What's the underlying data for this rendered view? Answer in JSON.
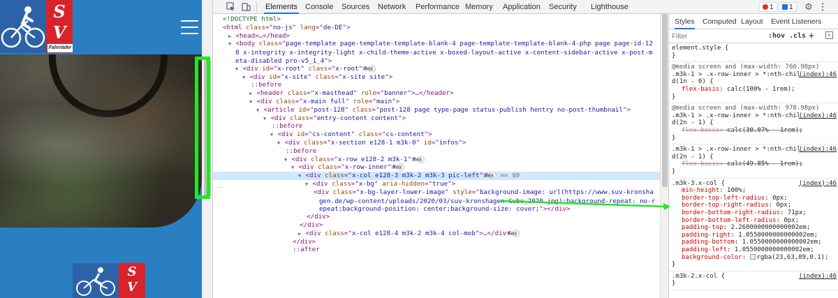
{
  "site": {
    "logo_letters": "S\nV",
    "logo_brand": "Fahrräder",
    "menu_icon": "hamburger-menu-icon"
  },
  "devtools": {
    "tabs": [
      "Elements",
      "Console",
      "Sources",
      "Network",
      "Performance",
      "Memory",
      "Application",
      "Security",
      "Lighthouse"
    ],
    "active_tab": "Elements",
    "error_count": "1",
    "message_count": "1",
    "colors": {
      "accent": "#1a73e8",
      "selected_row": "#cfe8fc",
      "highlight": "#22e822",
      "site_blue": "#2a7fc2",
      "logo_red": "#d8232a"
    }
  },
  "dom_lines": [
    {
      "indent": 0,
      "tri": "",
      "html": "<!DOCTYPE html>",
      "kind": "comment"
    },
    {
      "indent": 0,
      "tri": "",
      "tag": "html",
      "attrs": [
        [
          "class",
          "no-js"
        ],
        [
          "lang",
          "de-DE"
        ]
      ]
    },
    {
      "indent": 1,
      "tri": "▶",
      "raw": "<head>…</head>"
    },
    {
      "indent": 1,
      "tri": "▼",
      "tag": "body",
      "attrs": [
        [
          "class",
          "page-template page-template-template-blank-4 page-template-template-blank-4-php page page-id-128 x-integrity x-integrity-light x-child-theme-active x-boxed-layout-active x-content-sidebar-active x-post-meta-disabled pro-v5_1_4"
        ]
      ],
      "wrap": true
    },
    {
      "indent": 2,
      "tri": "▼",
      "tag": "div",
      "attrs": [
        [
          "id",
          "x-root"
        ],
        [
          "class",
          "x-root"
        ]
      ],
      "pill": "flex"
    },
    {
      "indent": 3,
      "tri": "▼",
      "tag": "div",
      "attrs": [
        [
          "id",
          "x-site"
        ],
        [
          "class",
          "x-site site"
        ]
      ]
    },
    {
      "indent": 4,
      "tri": "",
      "pseudo": "::before"
    },
    {
      "indent": 4,
      "tri": "▶",
      "tag": "header",
      "attrs": [
        [
          "class",
          "x-masthead"
        ],
        [
          "role",
          "banner"
        ]
      ],
      "collapsed": "header"
    },
    {
      "indent": 4,
      "tri": "▼",
      "tag": "div",
      "attrs": [
        [
          "class",
          "x-main full"
        ],
        [
          "role",
          "main"
        ]
      ]
    },
    {
      "indent": 5,
      "tri": "▼",
      "tag": "article",
      "attrs": [
        [
          "id",
          "post-128"
        ],
        [
          "class",
          "post-128 page type-page status-publish hentry no-post-thumbnail"
        ]
      ]
    },
    {
      "indent": 6,
      "tri": "▼",
      "tag": "div",
      "attrs": [
        [
          "class",
          "entry-content content"
        ]
      ]
    },
    {
      "indent": 7,
      "tri": "",
      "pseudo": "::before"
    },
    {
      "indent": 7,
      "tri": "▼",
      "tag": "div",
      "attrs": [
        [
          "id",
          "cs-content"
        ],
        [
          "class",
          "cs-content"
        ]
      ]
    },
    {
      "indent": 8,
      "tri": "▼",
      "tag": "div",
      "attrs": [
        [
          "class",
          "x-section e128-1 m3k-0"
        ],
        [
          "id",
          "infos"
        ]
      ]
    },
    {
      "indent": 9,
      "tri": "",
      "pseudo": "::before"
    },
    {
      "indent": 9,
      "tri": "▼",
      "tag": "div",
      "attrs": [
        [
          "class",
          "x-row e128-2 m3k-1"
        ]
      ],
      "pill": "flex"
    },
    {
      "indent": 10,
      "tri": "▼",
      "tag": "div",
      "attrs": [
        [
          "class",
          "x-row-inner"
        ]
      ],
      "pill": "flex"
    },
    {
      "indent": 11,
      "tri": "▼",
      "tag": "div",
      "attrs": [
        [
          "class",
          "x-col e128-3 m3k-2 m3k-3 pic-left"
        ]
      ],
      "pill": "flex",
      "ref": "== $0",
      "selected": true
    },
    {
      "indent": 12,
      "tri": "▼",
      "tag": "div",
      "attrs": [
        [
          "class",
          "x-bg"
        ],
        [
          "aria-hidden",
          "true"
        ]
      ]
    },
    {
      "indent": 13,
      "tri": "",
      "tag": "div",
      "attrs": [
        [
          "class",
          "x-bg-layer-lower-image"
        ],
        [
          "style",
          "background-image: url(https://www.suv-kronshagen.de/wp-content/uploads/2020/03/suv-kronshagen-Cube_2020.jpg);background-repeat: no-repeat;background-position: center;background-size: cover;"
        ]
      ],
      "close": "div",
      "wrap": true
    },
    {
      "indent": 12,
      "tri": "",
      "raw": "</div>"
    },
    {
      "indent": 11,
      "tri": "",
      "raw": "</div>"
    },
    {
      "indent": 11,
      "tri": "▶",
      "tag": "div",
      "attrs": [
        [
          "class",
          "x-col e128-4 m3k-2 m3k-4 col-mob"
        ]
      ],
      "collapsed": "div",
      "pill": "flex"
    },
    {
      "indent": 10,
      "tri": "",
      "raw": "</div>"
    },
    {
      "indent": 10,
      "tri": "",
      "pseudo": "::after"
    }
  ],
  "styles": {
    "sub_tabs": [
      "Styles",
      "Computed",
      "Layout",
      "Event Listeners"
    ],
    "active_sub_tab": "Styles",
    "filter_placeholder": "Filter",
    "hov": ":hov",
    "cls": ".cls",
    "rules": [
      {
        "selector": "element.style {",
        "props": [],
        "source": ""
      },
      {
        "media": "@media screen and (max-width: 766.98px)",
        "selector": ".m3k-1 > .x-row-inner > *:nth-child(1n - 0) {",
        "props": [
          [
            "flex-basis",
            "calc(100% - 1rem);",
            false
          ]
        ],
        "source": "(index):46"
      },
      {
        "media": "@media screen and (max-width: 978.98px)",
        "selector": ".m3k-1 > .x-row-inner > *:nth-child(2n - 1) {",
        "props": [
          [
            "flex-basis",
            "calc(30.07% - 1rem);",
            true
          ]
        ],
        "source": "(index):46"
      },
      {
        "media": "",
        "selector": ".m3k-1 > .x-row-inner > *:nth-child(2n - 1) {",
        "props": [
          [
            "flex-basis",
            "calc(49.85% - 1rem);",
            true
          ]
        ],
        "source": "(index):46"
      },
      {
        "media": "",
        "selector": ".m3k-3.x-col {",
        "props": [
          [
            "min-height",
            "100%;",
            false
          ],
          [
            "border-top-left-radius",
            "0px;",
            false
          ],
          [
            "border-top-right-radius",
            "0px;",
            false
          ],
          [
            "border-bottom-right-radius",
            "71px;",
            false
          ],
          [
            "border-bottom-left-radius",
            "0px;",
            false
          ],
          [
            "padding-top",
            "2.2600000000000002em;",
            false
          ],
          [
            "padding-right",
            "1.0550000000000002em;",
            false
          ],
          [
            "padding-bottom",
            "1.0550000000000002em;",
            false
          ],
          [
            "padding-left",
            "1.0550000000000002em;",
            false
          ],
          [
            "background-color",
            "rgba(23,63,89,0.1);",
            false
          ]
        ],
        "source": "(index):46"
      },
      {
        "media": "",
        "selector": ".m3k-2.x-col {",
        "props": [],
        "source": "(index):46"
      }
    ]
  }
}
